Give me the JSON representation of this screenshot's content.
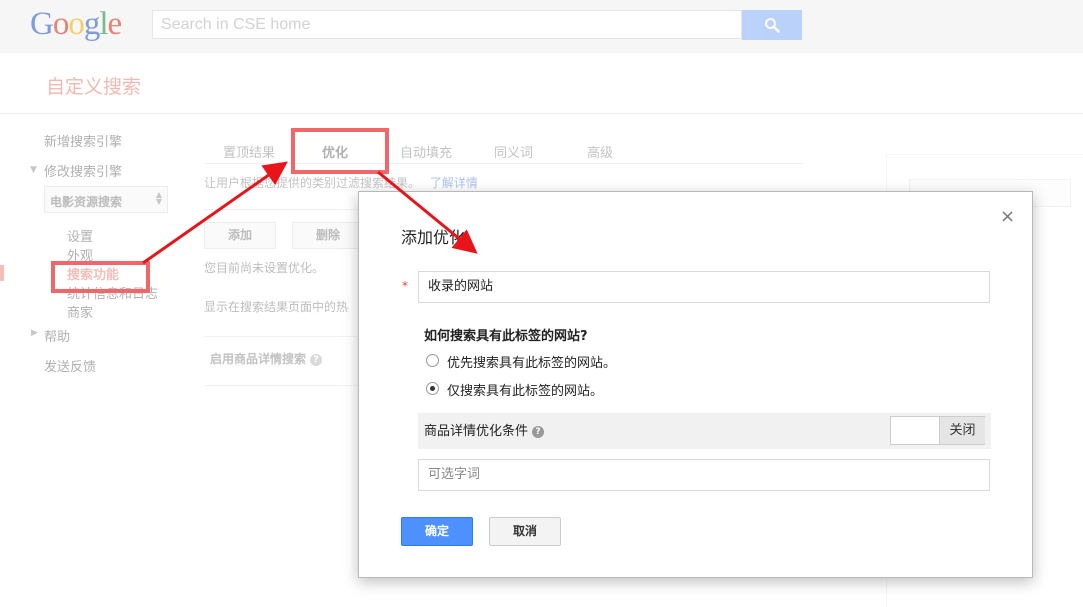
{
  "header": {
    "logo_letters": [
      "G",
      "o",
      "o",
      "g",
      "l",
      "e"
    ],
    "search_placeholder": "Search in CSE home"
  },
  "app": {
    "title": "自定义搜索"
  },
  "sidebar": {
    "new_engine": "新增搜索引擎",
    "edit_engine": "修改搜索引擎",
    "engine_select": "电影资源搜索",
    "sub_items": [
      "设置",
      "外观",
      "搜索功能",
      "统计信息和日志",
      "商家"
    ],
    "help": "帮助",
    "feedback": "发送反馈"
  },
  "tabs": [
    "置顶结果",
    "优化",
    "自动填充",
    "同义词",
    "高级"
  ],
  "main": {
    "description": "让用户根据您提供的类别过滤搜索结果。",
    "learn_more": "了解详情",
    "add_button": "添加",
    "delete_button": "删除",
    "empty_text": "您目前尚未设置优化。",
    "display_text": "显示在搜索结果页面中的热",
    "product_search_label": "启用商品详情搜索"
  },
  "dialog": {
    "title": "添加优化",
    "close": "×",
    "required_mark": "*",
    "name_value": "收录的网站",
    "question": "如何搜索具有此标签的网站?",
    "options": [
      "优先搜索具有此标签的网站。",
      "仅搜索具有此标签的网站。"
    ],
    "selected_option": 1,
    "condition_label": "商品详情优化条件",
    "toggle_label": "关闭",
    "optional_placeholder": "可选字词",
    "ok": "确定",
    "cancel": "取消"
  },
  "colors": {
    "annotation_red": "#e8141a",
    "primary_blue": "#4d90fe",
    "title_red": "#dd4b39"
  }
}
